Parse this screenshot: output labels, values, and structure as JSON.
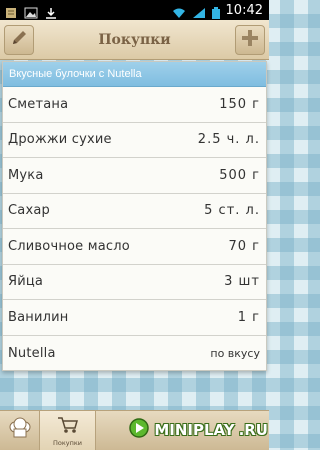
{
  "status_bar": {
    "time": "10:42",
    "icons": [
      "notes-icon",
      "image-icon",
      "download-icon",
      "wifi-icon",
      "signal-icon",
      "battery-icon"
    ]
  },
  "action_bar": {
    "title": "Покупки",
    "left_button_icon": "pencil-icon",
    "right_button_icon": "plus-icon"
  },
  "recipe": {
    "name": "Вкусные булочки с Nutella",
    "ingredients": [
      {
        "name": "Сметана",
        "qty": "150  г"
      },
      {
        "name": "Дрожжи сухие",
        "qty": "2.5 ч. л."
      },
      {
        "name": "Мука",
        "qty": "500 г"
      },
      {
        "name": "Сахар",
        "qty": "5  ст. л."
      },
      {
        "name": "Сливочное масло",
        "qty": "70 г"
      },
      {
        "name": "Яйца",
        "qty": "3  шт"
      },
      {
        "name": "Ванилин",
        "qty": "1 г"
      },
      {
        "name": "Nutella",
        "qty": "по вкусу"
      }
    ]
  },
  "tab_bar": {
    "tabs": [
      {
        "icon": "chef-hat-icon",
        "label": ""
      },
      {
        "icon": "cart-icon",
        "label": "Покупки"
      }
    ]
  },
  "watermark": {
    "text": "MINIPLAY",
    "domain": ".RU"
  },
  "colors": {
    "header_blue": "#8ac6e6",
    "bar_beige": "#dccaa6",
    "title_brown": "#7a6245"
  }
}
